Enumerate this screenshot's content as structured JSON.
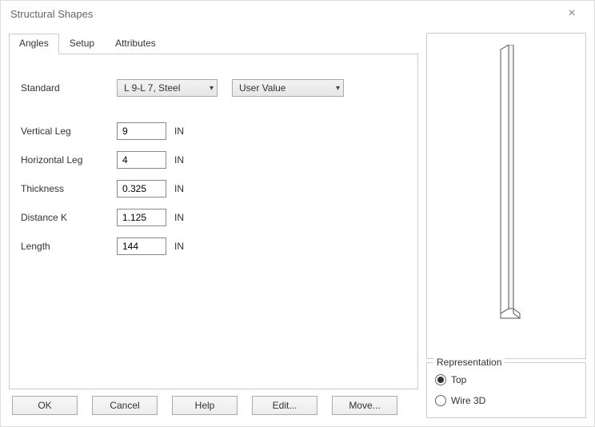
{
  "title": "Structural Shapes",
  "tabs": {
    "angles": "Angles",
    "setup": "Setup",
    "attributes": "Attributes"
  },
  "standard": {
    "label": "Standard",
    "value": "L 9-L 7, Steel",
    "extra_value": "User Value"
  },
  "fields": {
    "vertical_leg": {
      "label": "Vertical Leg",
      "value": "9",
      "unit": "IN"
    },
    "horizontal_leg": {
      "label": "Horizontal Leg",
      "value": "4",
      "unit": "IN"
    },
    "thickness": {
      "label": "Thickness",
      "value": "0.325",
      "unit": "IN"
    },
    "distance_k": {
      "label": "Distance K",
      "value": "1.125",
      "unit": "IN"
    },
    "length": {
      "label": "Length",
      "value": "144",
      "unit": "IN"
    }
  },
  "buttons": {
    "ok": "OK",
    "cancel": "Cancel",
    "help": "Help",
    "edit": "Edit...",
    "move": "Move..."
  },
  "representation": {
    "legend": "Representation",
    "top": "Top",
    "wire3d": "Wire 3D",
    "selected": "top"
  }
}
